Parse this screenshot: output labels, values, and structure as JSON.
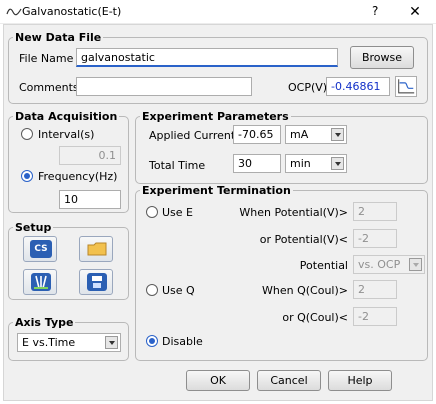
{
  "window": {
    "title": "Galvanostatic(E-t)",
    "help_glyph": "?",
    "close_glyph": "✕"
  },
  "new_data_file": {
    "legend": "New Data File",
    "file_name_label": "File Name",
    "file_name_value": "galvanostatic",
    "browse_label": "Browse",
    "comments_label": "Comments",
    "comments_value": "",
    "ocp_label": "OCP(V)",
    "ocp_value": "-0.46861"
  },
  "data_acquisition": {
    "legend": "Data Acquisition",
    "interval_label": "Interval(s)",
    "interval_value": "0.1",
    "frequency_label": "Frequency(Hz)",
    "frequency_value": "10",
    "selected": "frequency"
  },
  "setup": {
    "legend": "Setup",
    "cs_label": "CS"
  },
  "axis_type": {
    "legend": "Axis Type",
    "value": "E vs.Time"
  },
  "experiment_parameters": {
    "legend": "Experiment Parameters",
    "applied_current_label": "Applied Current",
    "applied_current_value": "-70.65",
    "applied_current_unit": "mA",
    "total_time_label": "Total Time",
    "total_time_value": "30",
    "total_time_unit": "min"
  },
  "experiment_termination": {
    "legend": "Experiment Termination",
    "use_e_label": "Use E",
    "when_potential_label": "When Potential(V)>",
    "when_potential_value": "2",
    "or_potential_label": "or Potential(V)<",
    "or_potential_value": "-2",
    "potential_label": "Potential",
    "potential_ref": "vs. OCP",
    "use_q_label": "Use Q",
    "when_q_label": "When Q(Coul)>",
    "when_q_value": "2",
    "or_q_label": "or Q(Coul)<",
    "or_q_value": "-2",
    "disable_label": "Disable",
    "selected": "disable"
  },
  "buttons": {
    "ok": "OK",
    "cancel": "Cancel",
    "help": "Help"
  },
  "colors": {
    "accent": "#2a62c9",
    "ocp_text": "#1230c8",
    "window_bg": "#f0f0f0"
  }
}
